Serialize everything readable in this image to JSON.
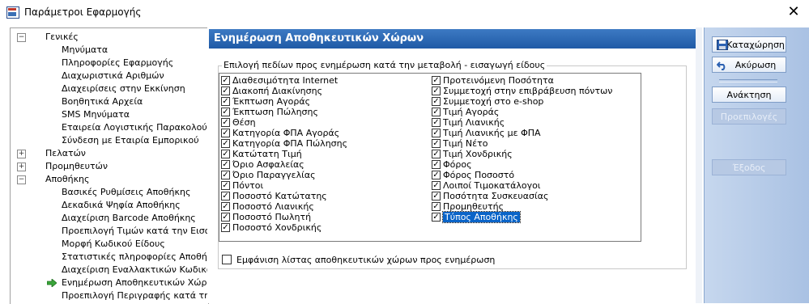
{
  "window": {
    "title": "Παράμετροι Εφαρμογής",
    "close_label": "✕"
  },
  "tree": {
    "items": [
      {
        "label": "Γενικές",
        "expander": "−"
      },
      {
        "label": "Μηνύματα"
      },
      {
        "label": "Πληροφορίες Εφαρμογής"
      },
      {
        "label": "Διαχωριστικά Αριθμών"
      },
      {
        "label": "Διαχειρίσεις στην Εκκίνηση"
      },
      {
        "label": "Βοηθητικά Αρχεία"
      },
      {
        "label": "SMS Μηνύματα"
      },
      {
        "label": "Εταιρεία Λογιστικής Παρακολούθησης"
      },
      {
        "label": "Σύνδεση με Εταιρία Εμπορικού"
      },
      {
        "label": "Πελατών",
        "expander": "+"
      },
      {
        "label": "Προμηθευτών",
        "expander": "+"
      },
      {
        "label": "Αποθήκης",
        "expander": "−"
      },
      {
        "label": "Βασικές Ρυθμίσεις Αποθήκης"
      },
      {
        "label": "Δεκαδικά Ψηφία Αποθήκης"
      },
      {
        "label": "Διαχείριση Barcode Αποθήκης"
      },
      {
        "label": "Προεπιλογή Τιμών κατά την Εισαγωγή"
      },
      {
        "label": "Μορφή Κωδικού Είδους"
      },
      {
        "label": "Στατιστικές πληροφορίες Αποθήκης"
      },
      {
        "label": "Διαχείριση Εναλλακτικών Κωδικών (Α"
      },
      {
        "label": "Ενημέρωση Αποθηκευτικών Χώρων"
      },
      {
        "label": "Προεπιλογή Περιγραφής κατά την Εισ"
      }
    ]
  },
  "main": {
    "header": "Ενημέρωση Αποθηκευτικών Χώρων",
    "group_title": "Επιλογή πεδίων προς ενημέρωση κατά την μεταβολή - εισαγωγή είδους",
    "left_fields": [
      "Διαθεσιμότητα Internet",
      "Διακοπή Διακίνησης",
      "Έκπτωση Αγοράς",
      "Έκπτωση Πώλησης",
      "Θέση",
      "Κατηγορία ΦΠΑ Αγοράς",
      "Κατηγορία ΦΠΑ Πώλησης",
      "Κατώτατη Τιμή",
      "Όριο Ασφαλείας",
      "Όριο Παραγγελίας",
      "Πόντοι",
      "Ποσοστό Κατώτατης",
      "Ποσοστό Λιανικής",
      "Ποσοστό Πωλητή",
      "Ποσοστό Χονδρικής"
    ],
    "right_fields": [
      "Προτεινόμενη Ποσότητα",
      "Συμμετοχή στην επιβράβευση πόντων",
      "Συμμετοχή στο e-shop",
      "Τιμή Αγοράς",
      "Τιμή Λιανικής",
      "Τιμή Λιανικής με ΦΠΑ",
      "Τιμή Νέτο",
      "Τιμή Χονδρικής",
      "Φόρος",
      "Φόρος Ποσοστό",
      "Λοιποί Τιμοκατάλογοι",
      "Ποσότητα Συσκευασίας",
      "Προμηθευτής",
      "Τύπος Αποθήκης"
    ],
    "check_mark": "✓",
    "show_list_label": "Εμφάνιση λίστας αποθηκευτικών χώρων προς ενημέρωση"
  },
  "actions": {
    "save": "Καταχώρηση",
    "cancel": "Ακύρωση",
    "refresh": "Ανάκτηση",
    "defaults": "Προεπιλογές",
    "exit": "Έξοδος"
  },
  "colors": {
    "header": "#2a66b4",
    "selection": "#0a64c8",
    "sidebar": "#b9cde9"
  }
}
